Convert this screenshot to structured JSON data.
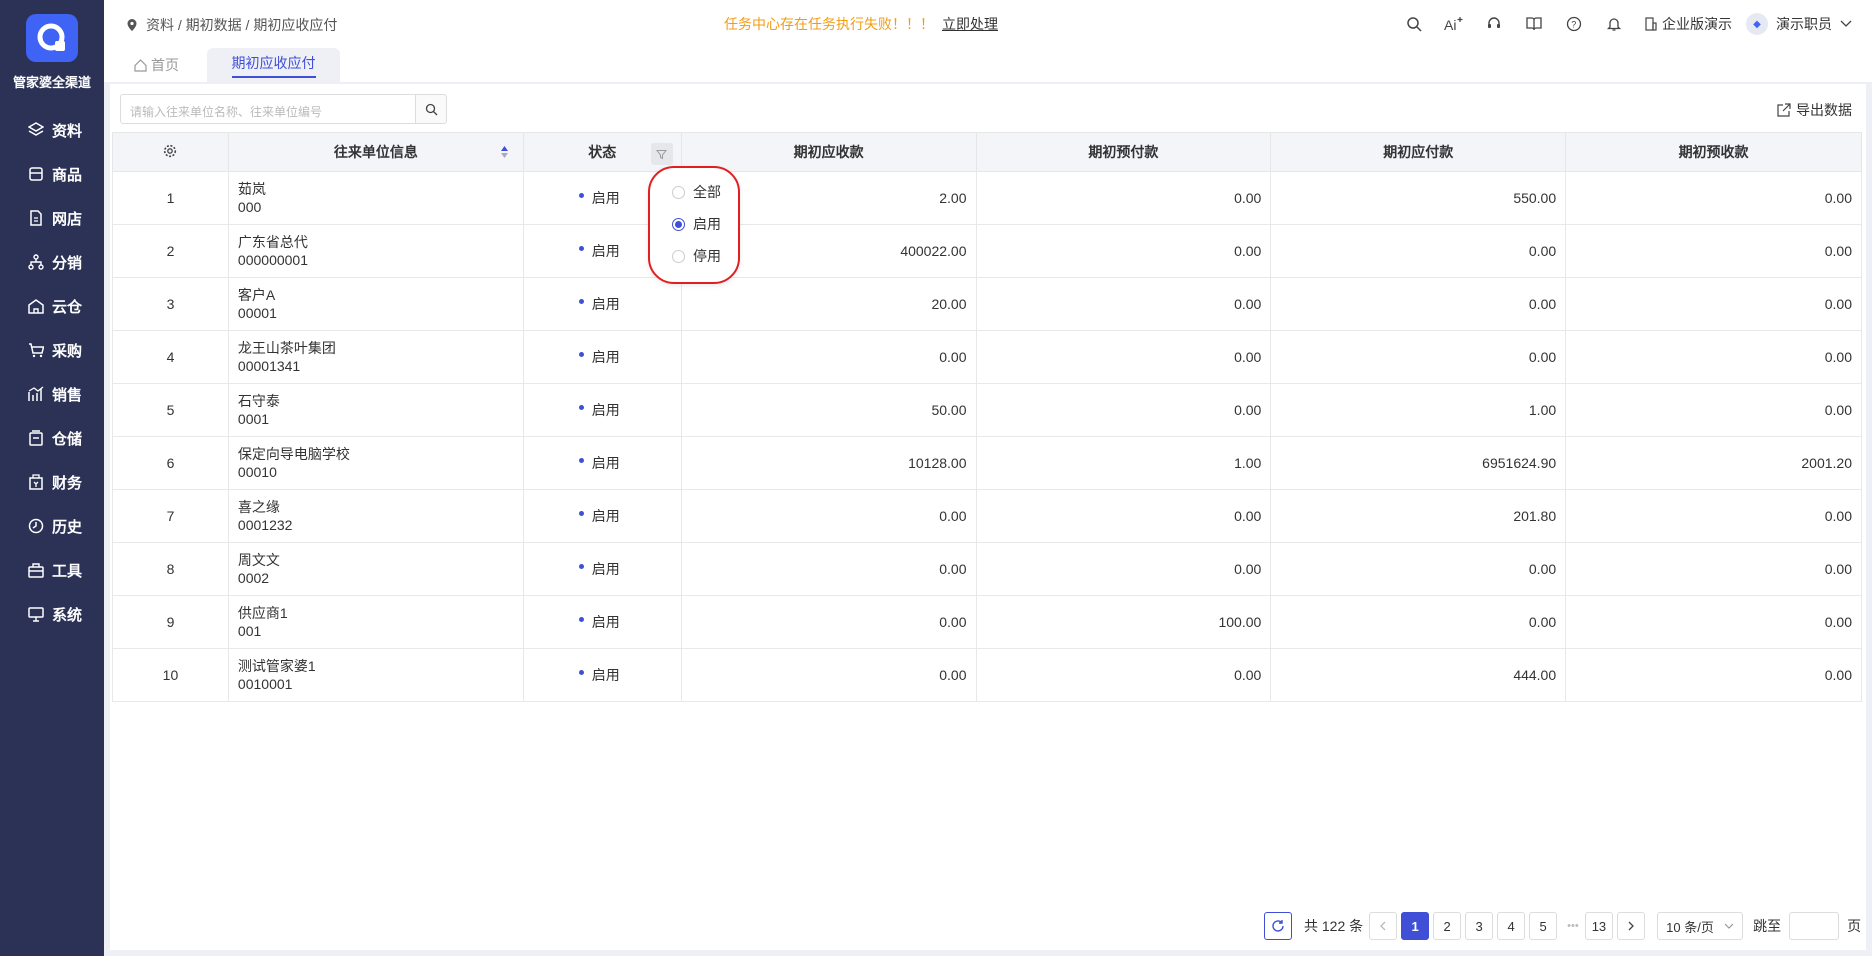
{
  "app": {
    "brand": "管家婆全渠道"
  },
  "sidebar": {
    "items": [
      {
        "label": "资料",
        "icon": "layers-icon"
      },
      {
        "label": "商品",
        "icon": "box-icon"
      },
      {
        "label": "网店",
        "icon": "shop-icon"
      },
      {
        "label": "分销",
        "icon": "network-icon"
      },
      {
        "label": "云仓",
        "icon": "warehouse-icon"
      },
      {
        "label": "采购",
        "icon": "cart-icon"
      },
      {
        "label": "销售",
        "icon": "chart-icon"
      },
      {
        "label": "仓储",
        "icon": "storage-icon"
      },
      {
        "label": "财务",
        "icon": "finance-icon"
      },
      {
        "label": "历史",
        "icon": "history-icon"
      },
      {
        "label": "工具",
        "icon": "toolbox-icon"
      },
      {
        "label": "系统",
        "icon": "monitor-icon"
      }
    ]
  },
  "header": {
    "breadcrumb": "资料 / 期初数据 / 期初应收应付",
    "alert": "任务中心存在任务执行失败！！！",
    "alert_action": "立即处理",
    "enterprise": "企业版演示",
    "user": "演示职员"
  },
  "tabs": {
    "home": "首页",
    "active": "期初应收应付"
  },
  "search": {
    "placeholder": "请输入往来单位名称、往来单位编号"
  },
  "toolbar": {
    "export": "导出数据"
  },
  "table": {
    "columns": [
      "往来单位信息",
      "状态",
      "期初应收款",
      "期初预付款",
      "期初应付款",
      "期初预收款"
    ],
    "rows": [
      {
        "idx": "1",
        "name": "茹岚",
        "code": "000",
        "status": "启用",
        "ar": "2.00",
        "prepay": "0.00",
        "ap": "550.00",
        "prerecv": "0.00"
      },
      {
        "idx": "2",
        "name": "广东省总代",
        "code": "000000001",
        "status": "启用",
        "ar": "400022.00",
        "prepay": "0.00",
        "ap": "0.00",
        "prerecv": "0.00"
      },
      {
        "idx": "3",
        "name": "客户A",
        "code": "00001",
        "status": "启用",
        "ar": "20.00",
        "prepay": "0.00",
        "ap": "0.00",
        "prerecv": "0.00"
      },
      {
        "idx": "4",
        "name": "龙王山茶叶集团",
        "code": "00001341",
        "status": "启用",
        "ar": "0.00",
        "prepay": "0.00",
        "ap": "0.00",
        "prerecv": "0.00"
      },
      {
        "idx": "5",
        "name": "石守泰",
        "code": "0001",
        "status": "启用",
        "ar": "50.00",
        "prepay": "0.00",
        "ap": "1.00",
        "prerecv": "0.00"
      },
      {
        "idx": "6",
        "name": "保定向导电脑学校",
        "code": "00010",
        "status": "启用",
        "ar": "10128.00",
        "prepay": "1.00",
        "ap": "6951624.90",
        "prerecv": "2001.20"
      },
      {
        "idx": "7",
        "name": "喜之缘",
        "code": "0001232",
        "status": "启用",
        "ar": "0.00",
        "prepay": "0.00",
        "ap": "201.80",
        "prerecv": "0.00"
      },
      {
        "idx": "8",
        "name": "周文文",
        "code": "0002",
        "status": "启用",
        "ar": "0.00",
        "prepay": "0.00",
        "ap": "0.00",
        "prerecv": "0.00"
      },
      {
        "idx": "9",
        "name": "供应商1",
        "code": "001",
        "status": "启用",
        "ar": "0.00",
        "prepay": "100.00",
        "ap": "0.00",
        "prerecv": "0.00"
      },
      {
        "idx": "10",
        "name": "测试管家婆1",
        "code": "0010001",
        "status": "启用",
        "ar": "0.00",
        "prepay": "0.00",
        "ap": "444.00",
        "prerecv": "0.00"
      }
    ]
  },
  "filter": {
    "options": [
      "全部",
      "启用",
      "停用"
    ],
    "selected": "启用"
  },
  "pagination": {
    "total": "共 122 条",
    "pages": [
      "1",
      "2",
      "3",
      "4",
      "5"
    ],
    "ellipsis": "•••",
    "last": "13",
    "page_size": "10 条/页",
    "goto_label": "跳至",
    "page_suffix": "页"
  },
  "colors": {
    "sidebar": "#2b3256",
    "accent": "#3f4fd6",
    "alert": "#f39c12"
  }
}
